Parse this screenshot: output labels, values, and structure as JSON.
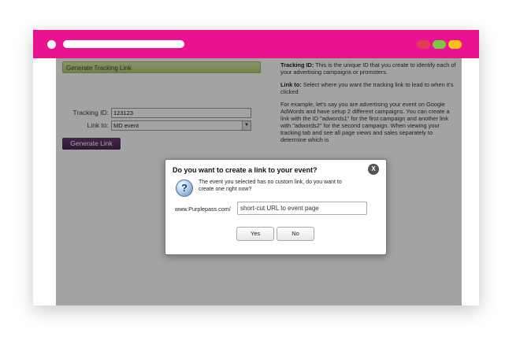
{
  "window": {
    "url_bar": "",
    "colors": {
      "chrome": "#e8138e",
      "close": "#e43b55",
      "minimize": "#7ac943",
      "maximize": "#fcc21b"
    }
  },
  "panel": {
    "header": "Generate Tracking Link",
    "tracking_label": "Tracking ID:",
    "tracking_value": "123123",
    "linkto_label": "Link to:",
    "linkto_value": "MD event",
    "generate_button": "Generate Link"
  },
  "help": {
    "p1_title": "Tracking ID:",
    "p1_text": " This is the unique ID that you create to identify each of your advertising campaigns or promoters.",
    "p2_title": "Link to:",
    "p2_text": " Select where you want the tracking link to lead to when it's clicked",
    "p3_text": "For example, let's say you are advertising your event on Google AdWords and have setup 2 different campaigns. You can create a link with the ID \"adwords1\" for the first campaign and another link with \"adwords2\" for the second campaign. When viewing your tracking tab and see all page views and sales separately to determine which is"
  },
  "dialog": {
    "title": "Do you want to create a link to your event?",
    "close": "X",
    "icon": "question-icon",
    "message": "The event you selected has no custom link, do you want to create one right now?",
    "url_prefix": "www.Purplepass.com/",
    "url_placeholder": "short-cut URL to event page",
    "yes": "Yes",
    "no": "No"
  }
}
